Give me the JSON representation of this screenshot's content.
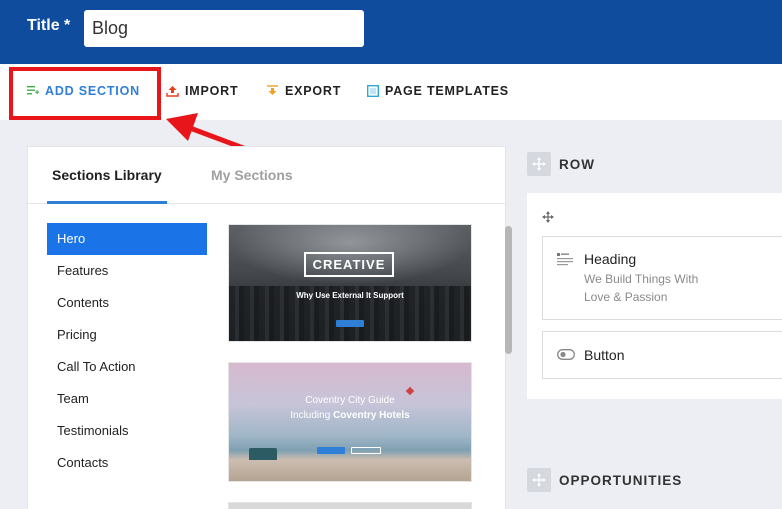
{
  "header": {
    "title_label": "Title *",
    "title_value": "Blog"
  },
  "toolbar": {
    "add_section": "ADD SECTION",
    "import": "IMPORT",
    "export": "EXPORT",
    "page_templates": "PAGE TEMPLATES"
  },
  "library": {
    "tabs": [
      "Sections Library",
      "My Sections"
    ],
    "categories": [
      "Hero",
      "Features",
      "Contents",
      "Pricing",
      "Call To Action",
      "Team",
      "Testimonials",
      "Contacts"
    ],
    "thumb1": {
      "title": "CREATIVE",
      "subtitle": "Why Use External It Support"
    },
    "thumb2": {
      "line1": "Coventry City Guide",
      "line2_a": "Including ",
      "line2_b": "Coventry Hotels"
    }
  },
  "row": {
    "label": "ROW",
    "heading": {
      "title": "Heading",
      "subtitle_1": "We Build Things With",
      "subtitle_2": "Love & Passion"
    },
    "button": {
      "title": "Button"
    }
  },
  "opportunities": {
    "label": "OPPORTUNITIES"
  },
  "colors": {
    "header_bg": "#0f4c9d",
    "accent": "#1b73e8",
    "highlight": "#e8161b"
  }
}
